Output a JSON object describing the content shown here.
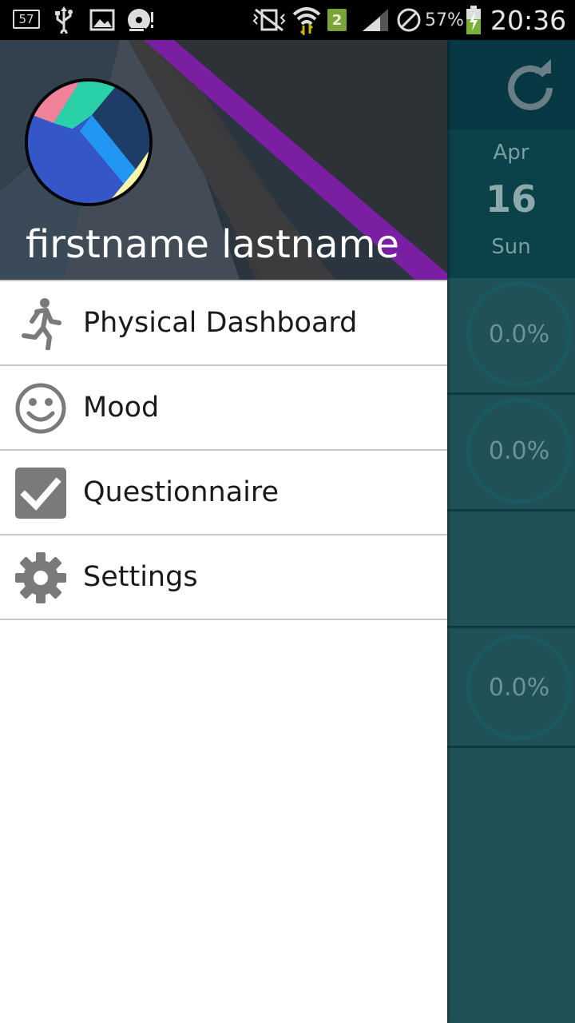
{
  "status_bar": {
    "notification_count": "57",
    "network_badge": "2",
    "battery_percent": "57%",
    "time": "20:36"
  },
  "drawer": {
    "user_name": "firstname lastname",
    "menu": [
      {
        "label": "Physical Dashboard",
        "icon": "running-person-icon"
      },
      {
        "label": "Mood",
        "icon": "smiley-face-icon"
      },
      {
        "label": "Questionnaire",
        "icon": "checkbox-icon"
      },
      {
        "label": "Settings",
        "icon": "gear-icon"
      }
    ]
  },
  "background_app": {
    "date": {
      "month": "Apr",
      "day": "16",
      "weekday": "Sun"
    },
    "progress_values": [
      "0.0%",
      "0.0%",
      "0.0%"
    ]
  },
  "colors": {
    "accent_purple": "#7b1fa2",
    "icon_gray": "#7a7a7a",
    "background_teal": "#1f5157"
  }
}
